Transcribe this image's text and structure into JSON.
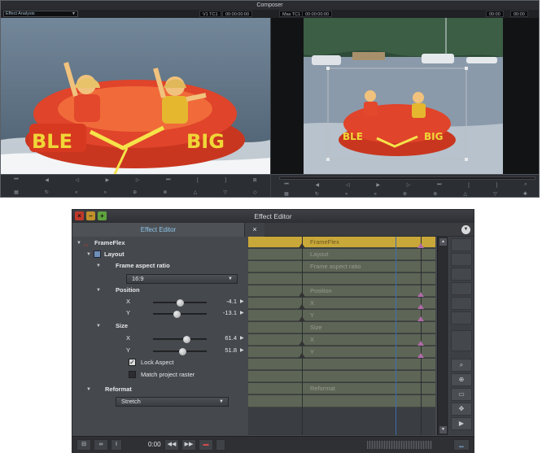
{
  "composer": {
    "title": "Composer",
    "app_label": "",
    "source_dropdown": "Effect Analysis",
    "tc_label_1": "V1 TC1",
    "tc_value_1": "00:00:00:00",
    "tc_label_2": "Mas TC1",
    "tc_value_2": "00:00:00:00",
    "tc_value_3": "00:00",
    "tc_value_4": "00:00"
  },
  "effect_editor": {
    "title": "Effect Editor",
    "tab_label": "Effect Editor",
    "tab_close": "×",
    "menu_icon": "chevron-down-icon",
    "params": {
      "frameflex": "FrameFlex",
      "layout": "Layout",
      "frame_aspect_ratio": "Frame aspect ratio",
      "aspect_value": "16:9",
      "position": "Position",
      "pos_x_label": "X",
      "pos_x_value": "-4.1",
      "pos_y_label": "Y",
      "pos_y_value": "-13.1",
      "size": "Size",
      "size_x_label": "X",
      "size_x_value": "61.4",
      "size_y_label": "Y",
      "size_y_value": "51.8",
      "lock_aspect": "Lock Aspect",
      "lock_aspect_checked": true,
      "match_raster": "Match project raster",
      "match_raster_checked": false,
      "reformat": "Reformat",
      "reformat_value": "Stretch"
    },
    "timeline_rows": [
      "FrameFlex",
      "Layout",
      "Frame aspect ratio",
      "",
      "Position",
      "X",
      "Y",
      "Size",
      "X",
      "Y",
      "",
      "",
      "Reformat",
      ""
    ],
    "bottom": {
      "time": "0:00"
    },
    "colors": {
      "accent_tab": "#8ec5e8",
      "keyframe_row_yellow": "#c9a83a",
      "keyframe_row": "#5d6656",
      "keyframe_marker": "#b06aa7"
    }
  }
}
